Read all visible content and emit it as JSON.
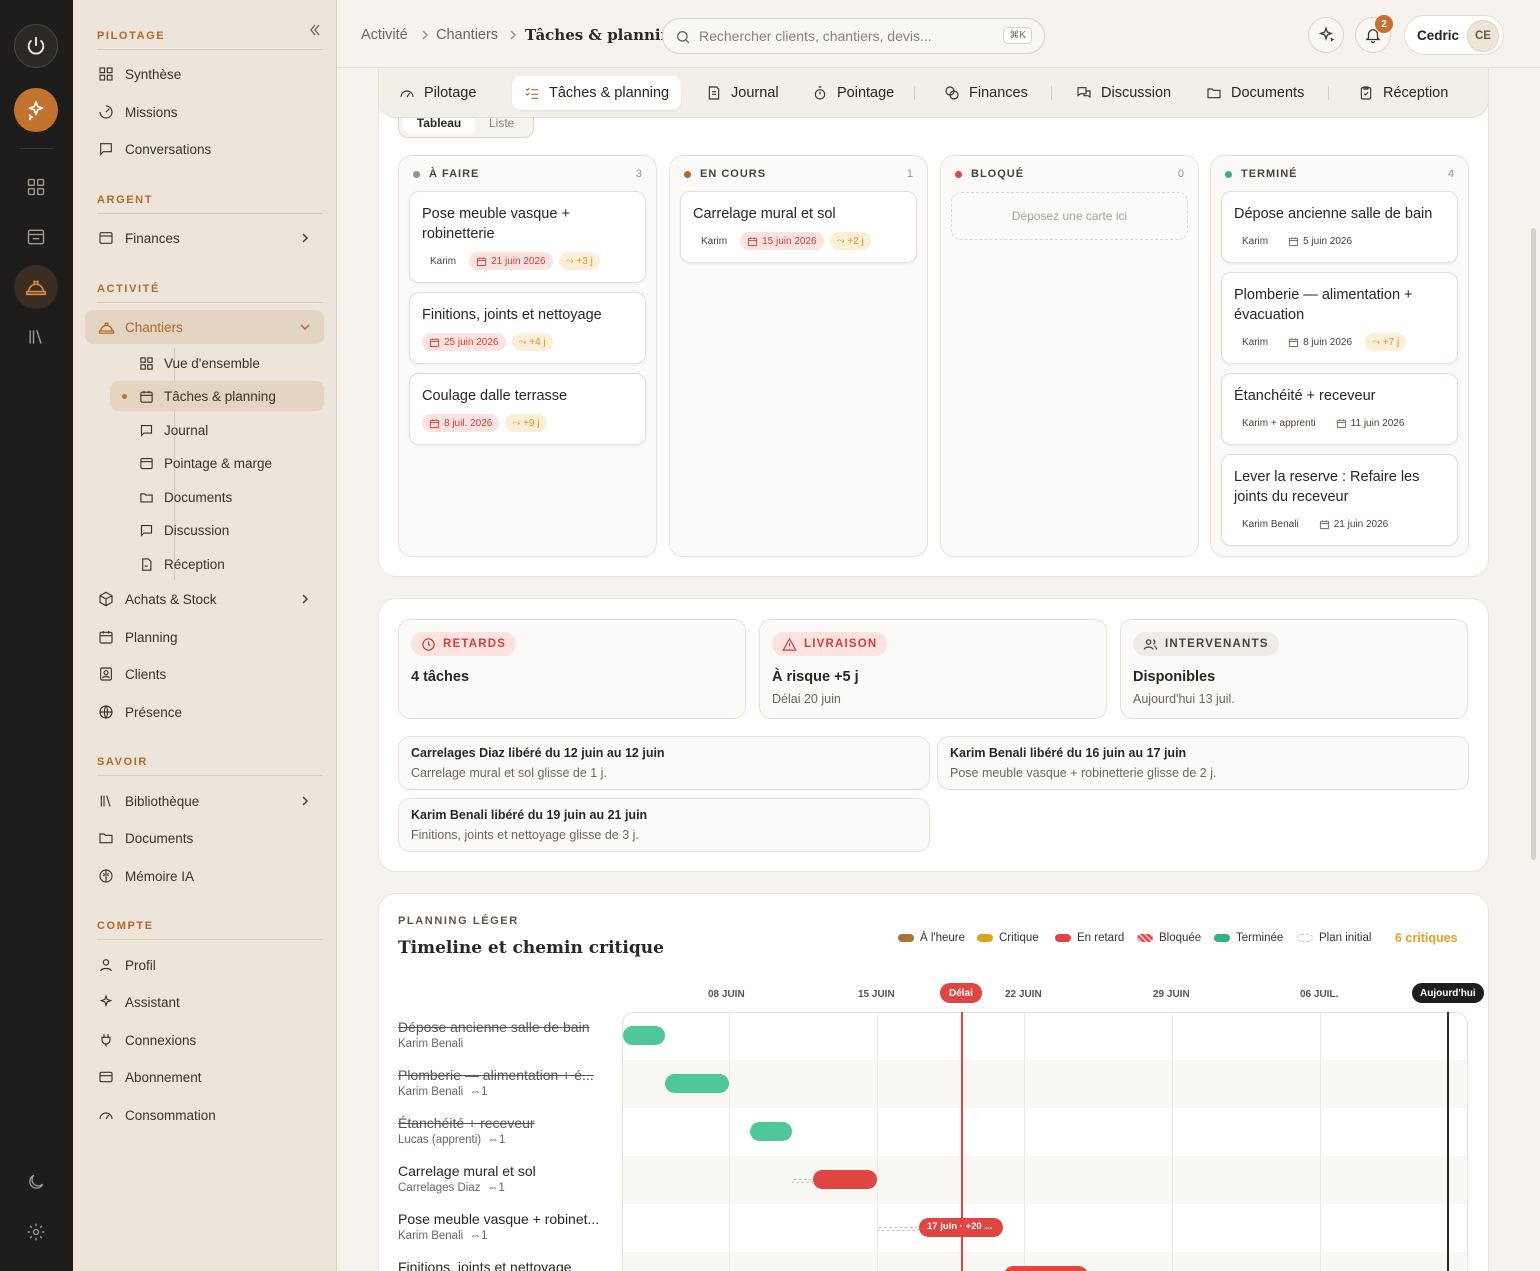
{
  "breadcrumb": [
    "Activité",
    "Chantiers",
    "Tâches & planning"
  ],
  "search": {
    "placeholder": "Rechercher clients, chantiers, devis...",
    "shortcut": "⌘K"
  },
  "notifications": {
    "count": "2"
  },
  "user": {
    "name": "Cedric",
    "initials": "CE"
  },
  "sidebar": {
    "sections": {
      "pilotage": "PILOTAGE",
      "argent": "ARGENT",
      "activite": "ACTIVITÉ",
      "savoir": "SAVOIR",
      "compte": "COMPTE"
    },
    "items": {
      "synthese": "Synthèse",
      "missions": "Missions",
      "conversations": "Conversations",
      "finances": "Finances",
      "chantiers": "Chantiers",
      "achats": "Achats & Stock",
      "planning": "Planning",
      "clients": "Clients",
      "presence": "Présence",
      "bibliotheque": "Bibliothèque",
      "documents": "Documents",
      "memoire": "Mémoire IA",
      "profil": "Profil",
      "assistant": "Assistant",
      "connexions": "Connexions",
      "abonnement": "Abonnement",
      "consommation": "Consommation"
    },
    "sub": {
      "vue": "Vue d'ensemble",
      "taches": "Tâches & planning",
      "journal": "Journal",
      "pointage": "Pointage & marge",
      "documents": "Documents",
      "discussion": "Discussion",
      "reception": "Réception"
    }
  },
  "tabs": [
    "Pilotage",
    "Tâches & planning",
    "Journal",
    "Pointage",
    "Finances",
    "Discussion",
    "Documents",
    "Réception"
  ],
  "view_toggle": [
    "Tableau",
    "Liste"
  ],
  "board": {
    "columns": [
      {
        "title": "À FAIRE",
        "count": "3",
        "color": "#9a9186"
      },
      {
        "title": "EN COURS",
        "count": "1",
        "color": "#b2692c"
      },
      {
        "title": "BLOQUÉ",
        "count": "0",
        "color": "#e04542",
        "empty": "Déposez une carte ici"
      },
      {
        "title": "TERMINÉ",
        "count": "4",
        "color": "#2fb37f"
      }
    ],
    "cards": {
      "a1": {
        "title": "Pose meuble vasque + robinetterie",
        "who": "Karim",
        "date": "21 juin 2026",
        "slip": "+3 j"
      },
      "a2": {
        "title": "Finitions, joints et nettoyage",
        "date": "25 juin 2026",
        "slip": "+4 j"
      },
      "a3": {
        "title": "Coulage dalle terrasse",
        "date": "8 juil. 2026",
        "slip": "+9 j"
      },
      "b1": {
        "title": "Carrelage mural et sol",
        "who": "Karim",
        "date": "15 juin 2026",
        "slip": "+2 j"
      },
      "d1": {
        "title": "Dépose ancienne salle de bain",
        "who": "Karim",
        "date": "5 juin 2026"
      },
      "d2": {
        "title": "Plomberie — alimentation + évacuation",
        "who": "Karim",
        "date": "8 juin 2026",
        "slip": "+7 j"
      },
      "d3": {
        "title": "Étanchéité + receveur",
        "who": "Karim + apprenti",
        "date": "11 juin 2026"
      },
      "d4": {
        "title": "Lever la reserve : Refaire les joints du receveur",
        "who": "Karim Benali",
        "date": "21 juin 2026"
      }
    }
  },
  "alerts": [
    {
      "badge": "RETARDS",
      "value": "4 tâches",
      "sub": ""
    },
    {
      "badge": "LIVRAISON",
      "value": "À risque +5 j",
      "sub": "Délai 20 juin"
    },
    {
      "badge": "INTERVENANTS",
      "value": "Disponibles",
      "sub": "Aujourd'hui 13 juil."
    }
  ],
  "notes": [
    {
      "a": "Carrelages Diaz libéré du 12 juin au 12 juin",
      "b": "Carrelage mural et sol glisse de 1 j."
    },
    {
      "a": "Karim Benali libéré du 16 juin au 17 juin",
      "b": "Pose meuble vasque + robinetterie glisse de 2 j."
    },
    {
      "a": "Karim Benali libéré du 19 juin au 21 juin",
      "b": "Finitions, joints et nettoyage glisse de 3 j."
    }
  ],
  "planning": {
    "kicker": "PLANNING LÉGER",
    "title": "Timeline et chemin critique",
    "legend": [
      "À l'heure",
      "Critique",
      "En retard",
      "Bloquée",
      "Terminée",
      "Plan initial"
    ],
    "critical": "6 critiques",
    "dates": [
      "08 JUIN",
      "15 JUIN",
      "22 JUIN",
      "29 JUIN",
      "06 JUIL."
    ],
    "deadline_label": "Délai",
    "today_label": "Aujourd'hui",
    "rows": [
      {
        "name": "Dépose ancienne salle de bain",
        "who": "Karim Benali",
        "links": ""
      },
      {
        "name": "Plomberie — alimentation + é...",
        "who": "Karim Benali",
        "links": "1"
      },
      {
        "name": "Étanchéité + receveur",
        "who": "Lucas (apprenti)",
        "links": "1"
      },
      {
        "name": "Carrelage mural et sol",
        "who": "Carrelages Diaz",
        "links": "1"
      },
      {
        "name": "Pose meuble vasque + robinet...",
        "who": "Karim Benali",
        "links": "1"
      },
      {
        "name": "Finitions, joints et nettoyage",
        "who": "",
        "links": ""
      }
    ],
    "late_bar_label": "17 juin · +20 ..."
  },
  "colors": {
    "accent": "#c4732f",
    "ontime": "#a87436",
    "critical": "#e1a21f",
    "late": "#e04542",
    "done": "#4fc79a"
  }
}
